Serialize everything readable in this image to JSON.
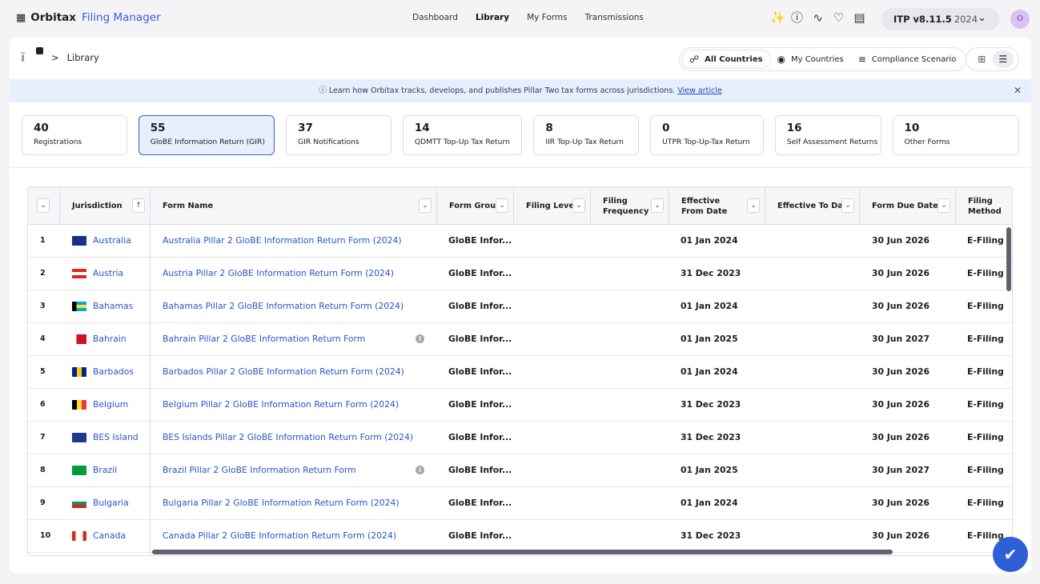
{
  "app": {
    "grid_icon": "apps-grid-icon",
    "brand_bold": "Orbitax",
    "brand_rest": "Filing Manager"
  },
  "nav": {
    "items": [
      "Dashboard",
      "Library",
      "My Forms",
      "Transmissions"
    ],
    "active": "Library"
  },
  "toolbar": {
    "icons": [
      "sparkle-icon",
      "info-icon",
      "activity-icon",
      "bell-icon",
      "chat-icon"
    ]
  },
  "version": {
    "label": "ITP v8.11.5",
    "year": "2024"
  },
  "user": {
    "initial": "O"
  },
  "breadcrumb": {
    "separator": ">",
    "current": "Library"
  },
  "scope": {
    "options": [
      "All Countries",
      "My Countries",
      "Compliance Scenario"
    ],
    "selected": "All Countries"
  },
  "view_toggle": {
    "options": [
      "grid-view-icon",
      "list-view-icon"
    ],
    "selected": "list-view-icon"
  },
  "banner": {
    "text": "Learn how Orbitax tracks, develops, and publishes Pillar Two tax forms across jurisdictions.",
    "link": "View article"
  },
  "stats": [
    {
      "count": "40",
      "label": "Registrations"
    },
    {
      "count": "55",
      "label": "GloBE Information Return (GIR)"
    },
    {
      "count": "37",
      "label": "GIR Notifications"
    },
    {
      "count": "14",
      "label": "QDMTT Top-Up Tax Return"
    },
    {
      "count": "8",
      "label": "IIR Top-Up Tax Return"
    },
    {
      "count": "0",
      "label": "UTPR Top-Up-Tax Return"
    },
    {
      "count": "16",
      "label": "Self Assessment Returns"
    },
    {
      "count": "10",
      "label": "Other Forms"
    }
  ],
  "stats_selected": 1,
  "table": {
    "columns": [
      "Jurisdiction",
      "Form Name",
      "Form Group",
      "Filing Level",
      "Filing Frequency",
      "Effective From Date",
      "Effective To Date",
      "Form Due Date",
      "Filing Method"
    ],
    "rows": [
      {
        "n": "1",
        "jurisdiction": "Australia",
        "form": "Australia Pillar 2 GloBE Information Return Form (2024)",
        "group": "GloBE Infor...",
        "from": "01 Jan 2024",
        "due": "30 Jun 2026",
        "method": "E-Filing (A",
        "info": false
      },
      {
        "n": "2",
        "jurisdiction": "Austria",
        "form": "Austria Pillar 2 GloBE Information Return Form (2024)",
        "group": "GloBE Infor...",
        "from": "31 Dec 2023",
        "due": "30 Jun 2026",
        "method": "E-Filing (F",
        "info": false
      },
      {
        "n": "3",
        "jurisdiction": "Bahamas",
        "form": "Bahamas Pillar 2 GloBE Information Return Form (2024)",
        "group": "GloBE Infor...",
        "from": "01 Jan 2024",
        "due": "30 Jun 2026",
        "method": "E-Filing (I",
        "info": false
      },
      {
        "n": "4",
        "jurisdiction": "Bahrain",
        "form": "Bahrain Pillar 2 GloBE Information Return Form",
        "group": "GloBE Infor...",
        "from": "01 Jan 2025",
        "due": "30 Jun 2027",
        "method": "E-Filing (N",
        "info": true
      },
      {
        "n": "5",
        "jurisdiction": "Barbados",
        "form": "Barbados Pillar 2 GloBE Information Return Form (2024)",
        "group": "GloBE Infor...",
        "from": "01 Jan 2024",
        "due": "30 Jun 2026",
        "method": "E-Filing (E",
        "info": false
      },
      {
        "n": "6",
        "jurisdiction": "Belgium",
        "form": "Belgium Pillar 2 GloBE Information Return Form (2024)",
        "group": "GloBE Infor...",
        "from": "31 Dec 2023",
        "due": "30 Jun 2026",
        "method": "E-Filing (N",
        "info": false
      },
      {
        "n": "7",
        "jurisdiction": "BES Island",
        "form": "BES Islands Pillar 2 GloBE Information Return Form (2024)",
        "group": "GloBE Infor...",
        "from": "31 Dec 2023",
        "due": "30 Jun 2026",
        "method": "E-Filing (N",
        "info": false
      },
      {
        "n": "8",
        "jurisdiction": "Brazil",
        "form": "Brazil Pillar 2 GloBE Information Return Form",
        "group": "GloBE Infor...",
        "from": "01 Jan 2025",
        "due": "30 Jun 2027",
        "method": "E-Filing (e",
        "info": true
      },
      {
        "n": "9",
        "jurisdiction": "Bulgaria",
        "form": "Bulgaria Pillar 2 GloBE Information Return Form (2024)",
        "group": "GloBE Infor...",
        "from": "01 Jan 2024",
        "due": "30 Jun 2026",
        "method": "E-Filing (N",
        "info": false
      },
      {
        "n": "10",
        "jurisdiction": "Canada",
        "form": "Canada Pillar 2 GloBE Information Return Form (2024)",
        "group": "GloBE Infor...",
        "from": "31 Dec 2023",
        "due": "30 Jun 2026",
        "method": "E-Filing (C",
        "info": false
      }
    ]
  },
  "colors": {
    "accent": "#3a5bd9",
    "link": "#2a55c9",
    "banner_bg": "#e6effb",
    "help_button": "#2f5fd6"
  }
}
